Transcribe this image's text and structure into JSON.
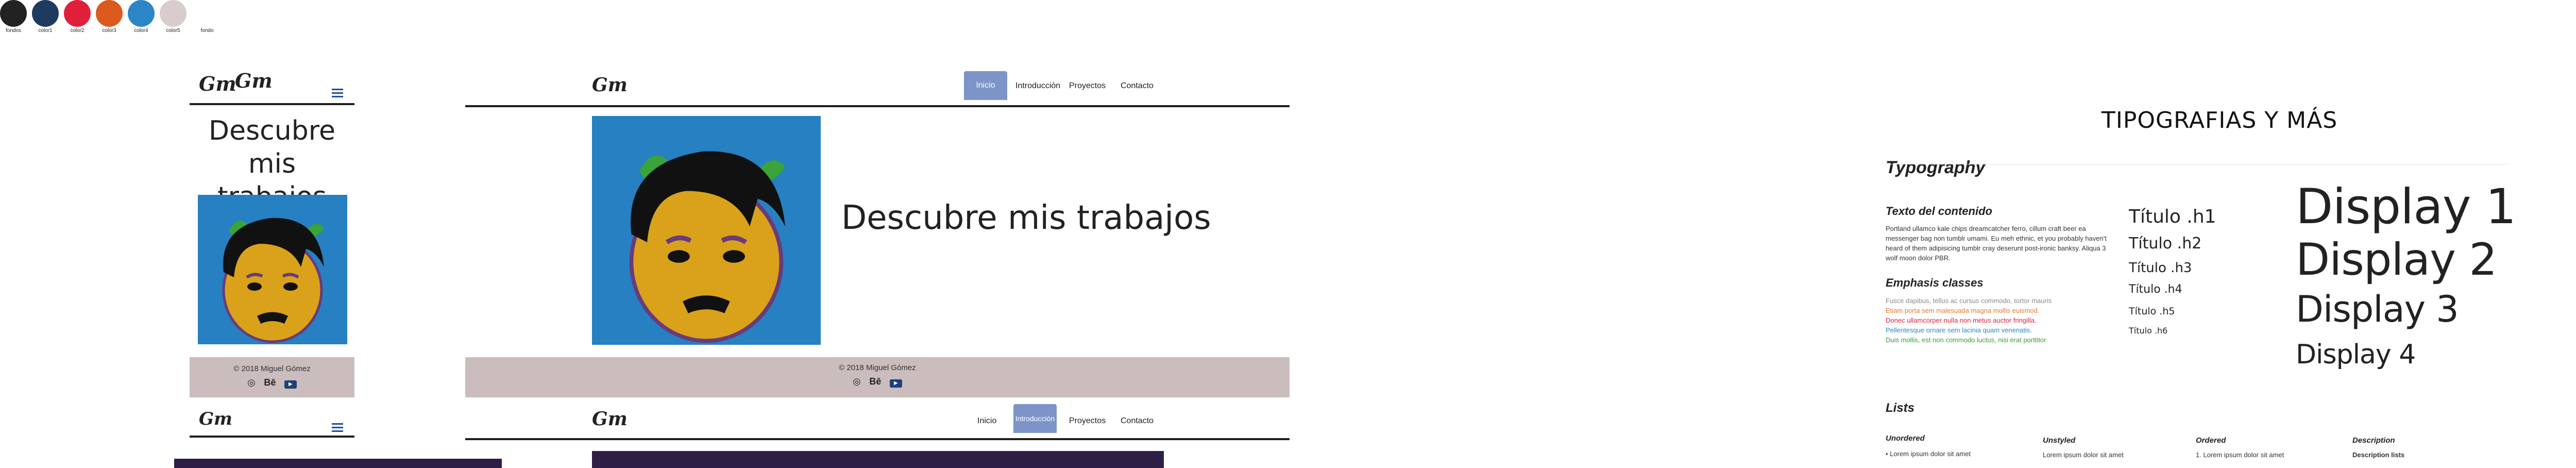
{
  "palette": [
    {
      "label": "fondos",
      "color": "#222222"
    },
    {
      "label": "color1",
      "color": "#1e3a5f"
    },
    {
      "label": "color2",
      "color": "#e0203a"
    },
    {
      "label": "color3",
      "color": "#dc5a1e"
    },
    {
      "label": "color4",
      "color": "#2b86c8"
    },
    {
      "label": "color5",
      "color": "#d8cccc"
    },
    {
      "label": "fondo",
      "color": "#ffffff"
    }
  ],
  "hero": {
    "title_mobile": "Descubre mis trabajos",
    "title_desktop": "Descubre mis trabajos"
  },
  "footer": {
    "copyright": "2018 Miguel Gómez",
    "behance": "Bē"
  },
  "nav": {
    "items": [
      "Inicio",
      "Introducción",
      "Proyectos",
      "Contacto"
    ]
  },
  "typography": {
    "title": "TIPOGRAFIAS Y MÁS",
    "section": "Typography",
    "content_heading": "Texto del contenido",
    "content_body": "Portland ullamco kale chips dreamcatcher ferro, cillum craft beer ea messenger bag non tumblr umami. Eu meh ethnic, et you probably haven't heard of them adipisicing tumblr cray deserunt post-ironic banksy. Aliqua 3 wolf moon dolor PBR.",
    "emphasis_heading": "Emphasis classes",
    "emphasis": [
      {
        "text": "Fusce dapibus, tellus ac cursus commodo, tortor mauris",
        "color": "#8a8a8a"
      },
      {
        "text": "Etiam porta sem malesuada magna mollis euismod.",
        "color": "#e07b2a"
      },
      {
        "text": "Donec ullamcorper nulla non metus auctor fringilla.",
        "color": "#e0203a"
      },
      {
        "text": "Pellentesque ornare sem lacinia quam venenatis.",
        "color": "#2b86c8"
      },
      {
        "text": "Duis mollis, est non commodo luctus, nisi erat porttitor",
        "color": "#3a9d3a"
      }
    ],
    "headings": [
      "Título .h1",
      "Título .h2",
      "Título .h3",
      "Título .h4",
      "Título .h5",
      "Título .h6"
    ],
    "displays": [
      "Display 1",
      "Display 2",
      "Display 3",
      "Display 4"
    ],
    "lists": {
      "title": "Lists",
      "columns": [
        {
          "heading": "Unordered",
          "item": "• Lorem ipsum dolor sit amet"
        },
        {
          "heading": "Unstyled",
          "item": "Lorem ipsum dolor sit amet"
        },
        {
          "heading": "Ordered",
          "item": "1. Lorem ipsum dolor sit amet"
        },
        {
          "heading": "Description",
          "item": "Description lists"
        }
      ]
    }
  }
}
